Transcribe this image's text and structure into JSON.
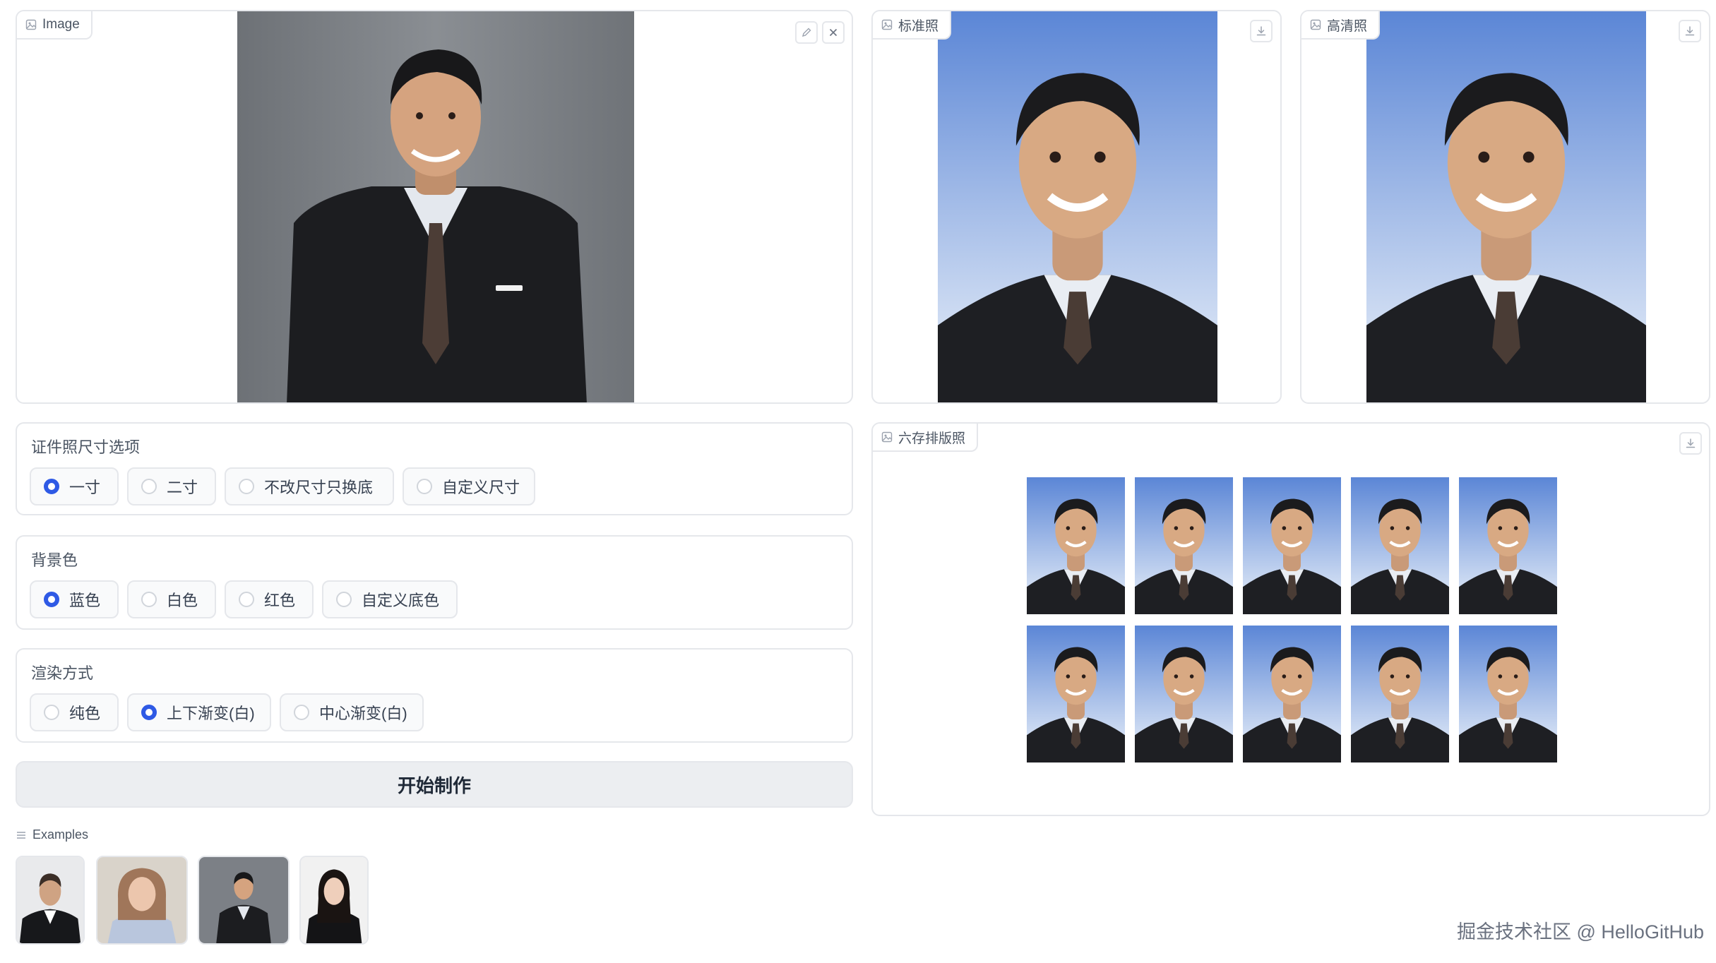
{
  "input_panel": {
    "label": "Image"
  },
  "standard_panel": {
    "label": "标准照"
  },
  "hd_panel": {
    "label": "高清照"
  },
  "layout_panel": {
    "label": "六存排版照"
  },
  "size_options": {
    "title": "证件照尺寸选项",
    "options": [
      "一寸",
      "二寸",
      "不改尺寸只换底",
      "自定义尺寸"
    ],
    "selected": "一寸"
  },
  "background_color": {
    "title": "背景色",
    "options": [
      "蓝色",
      "白色",
      "红色",
      "自定义底色"
    ],
    "selected": "蓝色"
  },
  "render_mode": {
    "title": "渲染方式",
    "options": [
      "纯色",
      "上下渐变(白)",
      "中心渐变(白)"
    ],
    "selected": "上下渐变(白)"
  },
  "start_button": {
    "label": "开始制作"
  },
  "examples": {
    "label": "Examples",
    "count": 4
  },
  "layout_grid": {
    "rows": 2,
    "columns": 5
  },
  "colors": {
    "accent": "#2f5ae5",
    "photo_blue_top": "#5b86d6",
    "photo_blue_bottom": "#e6edf9",
    "input_bg": "#777b81"
  },
  "watermark": "掘金技术社区 @ HelloGitHub"
}
